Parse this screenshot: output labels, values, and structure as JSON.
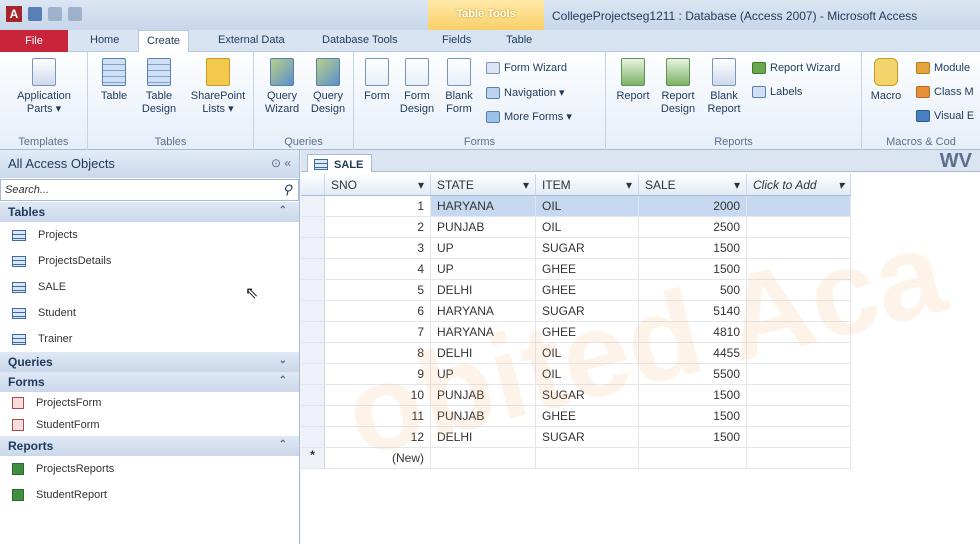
{
  "app": {
    "icon_letter": "A",
    "window_title": "CollegeProjectseg1211 : Database (Access 2007) - Microsoft Access",
    "contextual_tab_group": "Table Tools"
  },
  "tabs": [
    "File",
    "Home",
    "Create",
    "External Data",
    "Database Tools",
    "Fields",
    "Table"
  ],
  "ribbon": {
    "templates": {
      "label": "Templates",
      "app_parts": "Application",
      "app_parts2": "Parts ▾"
    },
    "tables": {
      "label": "Tables",
      "table": "Table",
      "table_design": "Table",
      "table_design2": "Design",
      "sharepoint": "SharePoint",
      "sharepoint2": "Lists ▾"
    },
    "queries": {
      "label": "Queries",
      "qwiz": "Query",
      "qwiz2": "Wizard",
      "qdes": "Query",
      "qdes2": "Design"
    },
    "forms": {
      "label": "Forms",
      "form": "Form",
      "form_design": "Form",
      "form_design2": "Design",
      "blank_form": "Blank",
      "blank_form2": "Form",
      "wizard": "Form Wizard",
      "navigation": "Navigation ▾",
      "more": "More Forms ▾"
    },
    "reports": {
      "label": "Reports",
      "report": "Report",
      "report_design": "Report",
      "report_design2": "Design",
      "blank_report": "Blank",
      "blank_report2": "Report",
      "wizard": "Report Wizard",
      "labels": "Labels"
    },
    "macros": {
      "label": "Macros & Cod",
      "macro": "Macro",
      "module": "Module",
      "class": "Class M",
      "vb": "Visual E"
    }
  },
  "nav": {
    "title": "All Access Objects",
    "search_placeholder": "Search...",
    "sections": {
      "tables": {
        "label": "Tables",
        "items": [
          "Projects",
          "ProjectsDetails",
          "SALE",
          "Student",
          "Trainer"
        ]
      },
      "queries": {
        "label": "Queries"
      },
      "forms": {
        "label": "Forms",
        "items": [
          "ProjectsForm",
          "StudentForm"
        ]
      },
      "reports": {
        "label": "Reports",
        "items": [
          "ProjectsReports",
          "StudentReport"
        ]
      }
    }
  },
  "document": {
    "tab": "SALE",
    "columns": [
      "SNO",
      "STATE",
      "ITEM",
      "SALE",
      "Click to Add"
    ],
    "rows": [
      [
        "1",
        "HARYANA",
        "OIL",
        "2000"
      ],
      [
        "2",
        "PUNJAB",
        "OIL",
        "2500"
      ],
      [
        "3",
        "UP",
        "SUGAR",
        "1500"
      ],
      [
        "4",
        "UP",
        "GHEE",
        "1500"
      ],
      [
        "5",
        "DELHI",
        "GHEE",
        "500"
      ],
      [
        "6",
        "HARYANA",
        "SUGAR",
        "5140"
      ],
      [
        "7",
        "HARYANA",
        "GHEE",
        "4810"
      ],
      [
        "8",
        "DELHI",
        "OIL",
        "4455"
      ],
      [
        "9",
        "UP",
        "OIL",
        "5500"
      ],
      [
        "10",
        "PUNJAB",
        "SUGAR",
        "1500"
      ],
      [
        "11",
        "PUNJAB",
        "GHEE",
        "1500"
      ],
      [
        "12",
        "DELHI",
        "SUGAR",
        "1500"
      ]
    ],
    "new_row_marker": "*",
    "new_row_label": "(New)"
  },
  "watermark": "obited Aca",
  "corner_text": "WV"
}
